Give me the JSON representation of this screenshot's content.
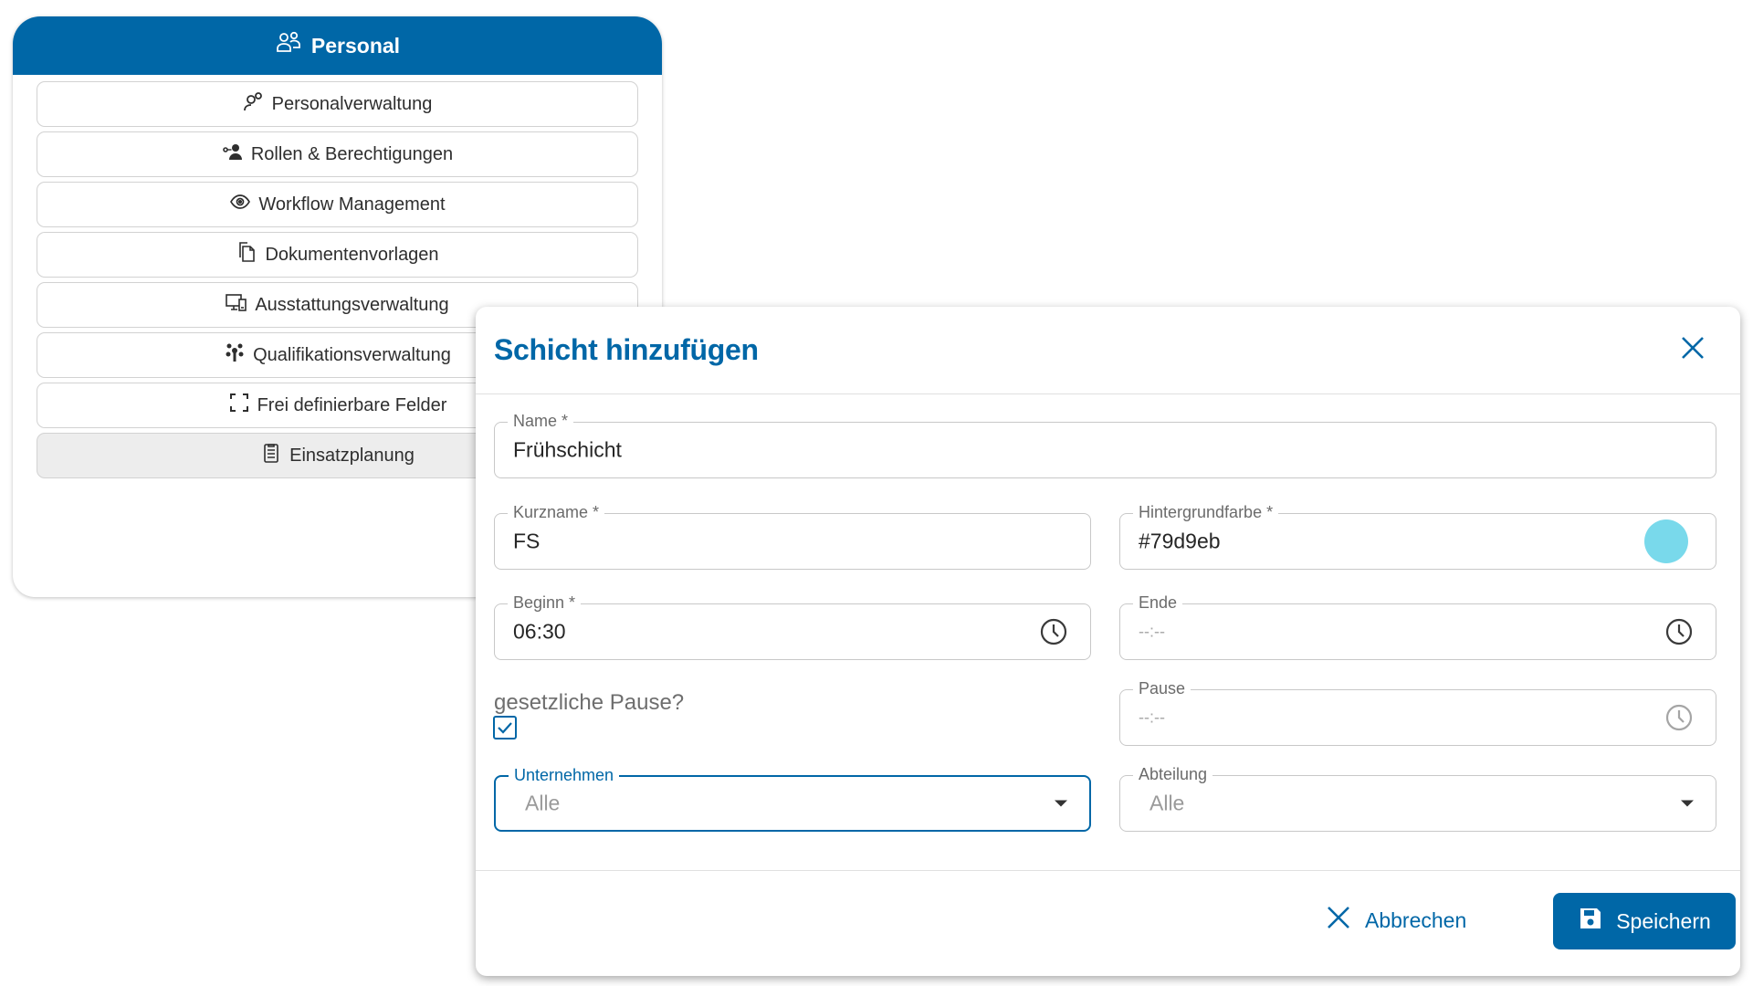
{
  "menu": {
    "title": "Personal",
    "header_icon": "people-group-icon",
    "items": [
      {
        "label": "Personalverwaltung",
        "icon": "person-settings-icon"
      },
      {
        "label": "Rollen & Berechtigungen",
        "icon": "user-key-icon"
      },
      {
        "label": "Workflow Management",
        "icon": "workflow-eye-icon"
      },
      {
        "label": "Dokumentenvorlagen",
        "icon": "documents-icon"
      },
      {
        "label": "Ausstattungsverwaltung",
        "icon": "devices-icon"
      },
      {
        "label": "Qualifikationsverwaltung",
        "icon": "skills-tree-icon"
      },
      {
        "label": "Frei definierbare Felder",
        "icon": "expand-frame-icon"
      },
      {
        "label": "Einsatzplanung",
        "icon": "clipboard-list-icon",
        "active": true
      }
    ]
  },
  "dialog": {
    "title": "Schicht hinzufügen",
    "fields": {
      "name": {
        "label": "Name  *",
        "value": "Frühschicht"
      },
      "kurzname": {
        "label": "Kurzname *",
        "value": "FS"
      },
      "hintergrundfarbe": {
        "label": "Hintergrundfarbe *",
        "value": "#79d9eb",
        "swatch_color": "#79d9eb"
      },
      "beginn": {
        "label": "Beginn *",
        "value": "06:30"
      },
      "ende": {
        "label": "Ende",
        "placeholder": "--:--"
      },
      "pause": {
        "label": "Pause",
        "placeholder": "--:--"
      },
      "unternehmen": {
        "label": "Unternehmen",
        "selected": "Alle"
      },
      "abteilung": {
        "label": "Abteilung",
        "selected": "Alle"
      }
    },
    "gesetzliche_pause": {
      "label": "gesetzliche Pause?",
      "checked": true
    },
    "buttons": {
      "cancel": "Abbrechen",
      "save": "Speichern"
    }
  },
  "colors": {
    "primary": "#0067a7",
    "border": "#c8c8c8",
    "active_item_bg": "#ededed"
  }
}
